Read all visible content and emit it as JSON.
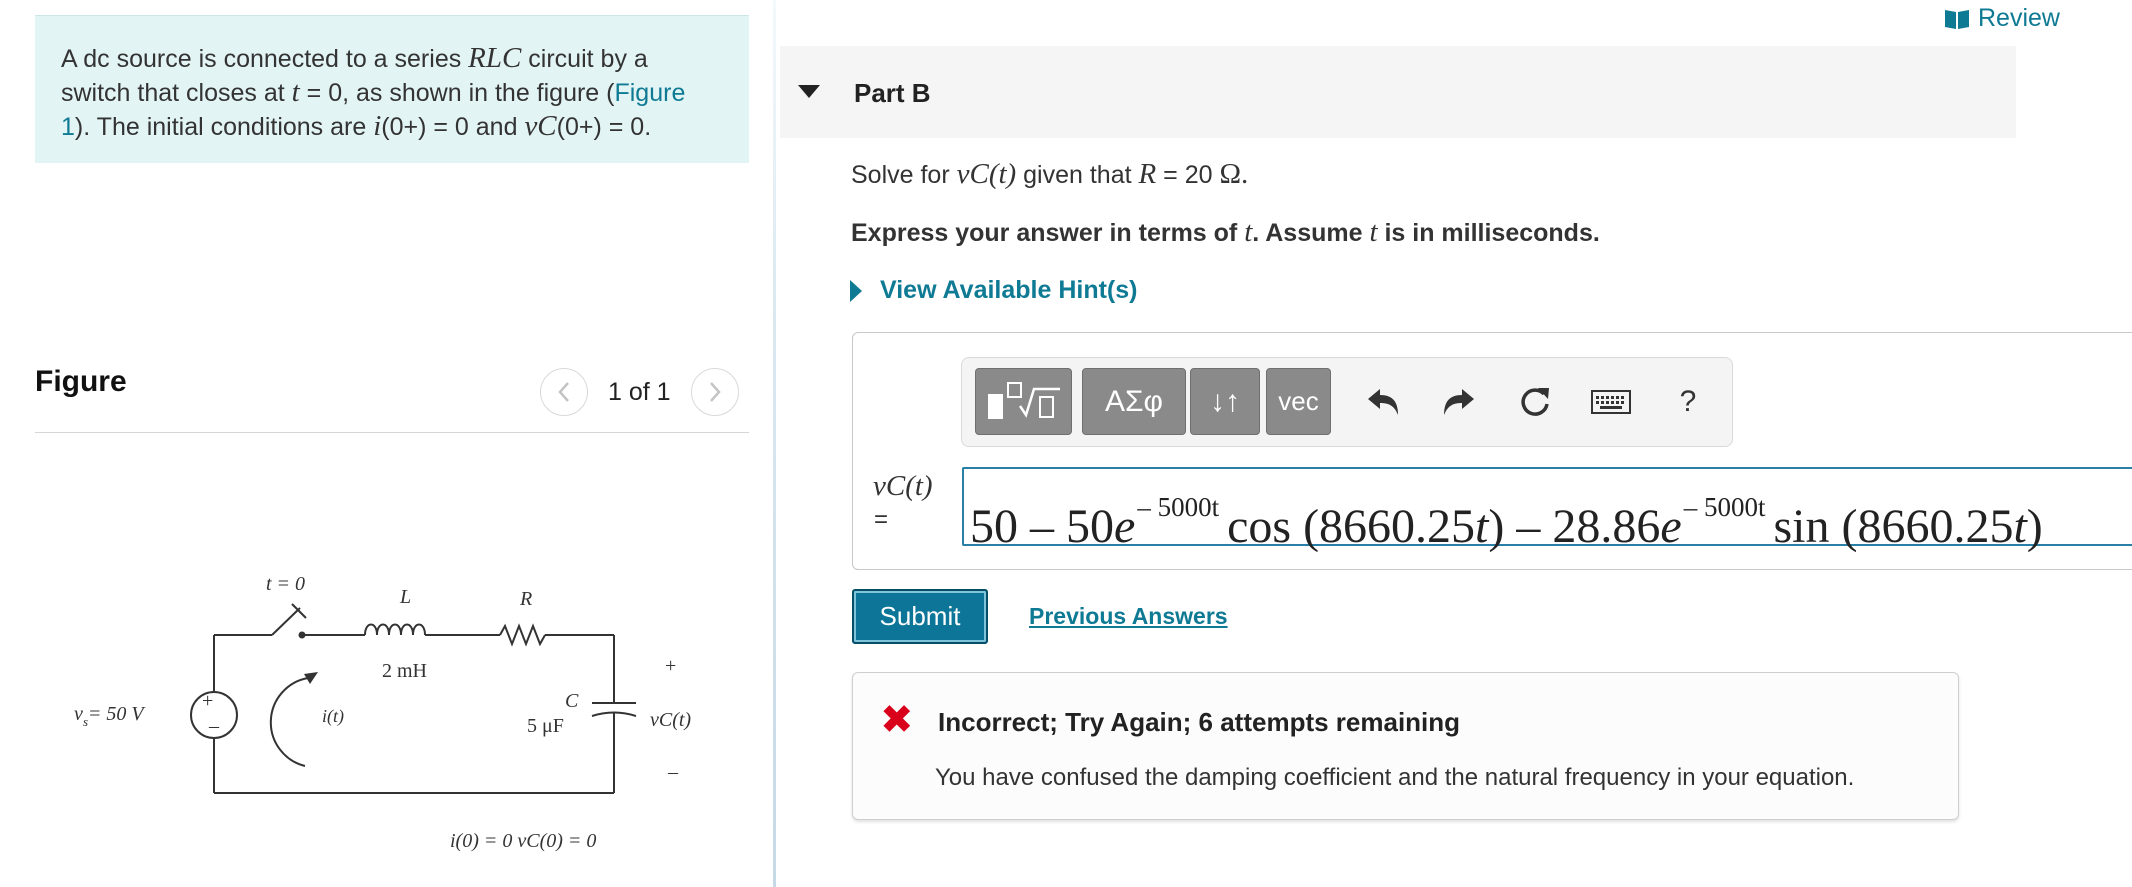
{
  "intro": {
    "line1_a": "A dc source is connected to a series ",
    "rlc": "RLC",
    "line1_b": " circuit by a",
    "line2_a": "switch that closes at ",
    "t": "t",
    "line2_b": " = 0, as shown in the figure (",
    "figure_link_a": "Figure",
    "figure_link_b": "1",
    "line3_a": "). The initial conditions are ",
    "i_sym": "i",
    "line3_b": "(0+) = 0 and ",
    "vc_sym": "vC",
    "line3_c": "(0+) = 0."
  },
  "figure": {
    "title": "Figure",
    "pager_text": "1 of 1",
    "prev_icon": "chevron-left-icon",
    "next_icon": "chevron-right-icon",
    "circuit_labels": {
      "switch": "t = 0",
      "inductor_name": "L",
      "inductor_value": "2 mH",
      "resistor_name": "R",
      "capacitor_name": "C",
      "capacitor_value": "5 μF",
      "source": "v = 50 V",
      "source_sub": "s",
      "current": "i(t)",
      "plus": "+",
      "minus": "–",
      "vc": "vC(t)",
      "initial": "i(0) = 0    vC(0) = 0"
    }
  },
  "review": {
    "label": "Review",
    "icon": "book-icon"
  },
  "part": {
    "title": "Part B",
    "caret_icon": "caret-down-icon"
  },
  "question": {
    "pre": "Solve for ",
    "vc": "vC(t)",
    "mid": " given that ",
    "R": "R",
    "post": " = 20 ",
    "unit": "Ω."
  },
  "instruction": {
    "a": "Express your answer in terms of ",
    "t1": "t",
    "b": ". Assume ",
    "t2": "t",
    "c": " is in milliseconds."
  },
  "hint": {
    "label": "View Available Hint(s)"
  },
  "toolbar": {
    "templates_icon": "templates-icon",
    "greek_label": "ΑΣφ",
    "arrows_label": "↓↑",
    "vec_label": "vec",
    "undo_icon": "undo-icon",
    "redo_icon": "redo-icon",
    "reset_icon": "reset-icon",
    "keyboard_icon": "keyboard-icon",
    "help_label": "?"
  },
  "answer": {
    "var_label": "vC(t)",
    "equals": "=",
    "expr_a": "50 – 50",
    "e1": "e",
    "exp1": "– 5000t",
    "expr_b": "cos (8660.25",
    "t1": "t",
    "expr_c": ") – 28.86",
    "e2": "e",
    "exp2": "– 5000t",
    "expr_d": "sin (8660.25",
    "t2": "t",
    "expr_e": ")"
  },
  "actions": {
    "submit_label": "Submit",
    "previous_answers_label": "Previous Answers"
  },
  "feedback": {
    "icon": "x-icon",
    "symbol": "✖",
    "title": "Incorrect; Try Again; 6 attempts remaining",
    "message": "You have confused the damping coefficient and the natural frequency in your equation.",
    "color": "#d9001b"
  }
}
